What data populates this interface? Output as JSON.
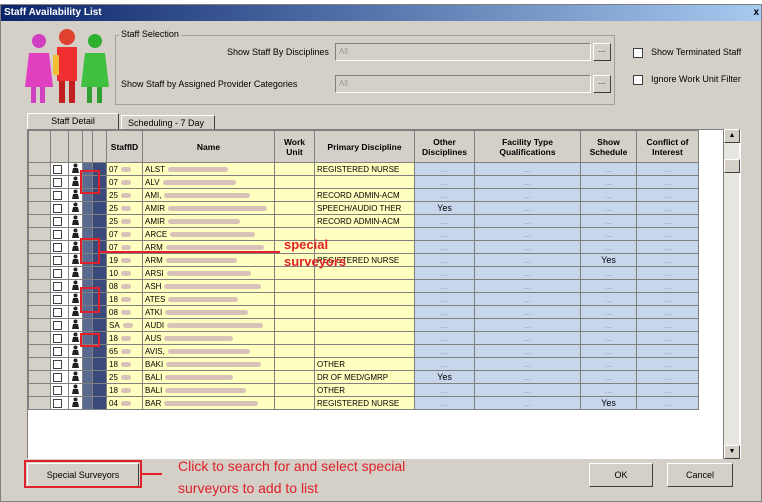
{
  "window": {
    "title": "Staff Availability List",
    "close": "x"
  },
  "selection": {
    "legend": "Staff Selection",
    "disciplines_label": "Show Staff By Disciplines",
    "disciplines_value": "All",
    "provider_label": "Show Staff by Assigned Provider Categories",
    "provider_value": "All",
    "show_terminated": "Show Terminated Staff",
    "ignore_work_unit": "Ignore Work Unit Filter"
  },
  "tabs": [
    "Staff Detail",
    "Scheduling - 7 Day"
  ],
  "grid": {
    "columns": [
      "StaffID",
      "Name",
      "Work Unit",
      "Primary Discipline",
      "Other Disciplines",
      "Facility Type Qualifications",
      "Show Schedule",
      "Conflict of Interest"
    ],
    "rows": [
      {
        "id": "07",
        "name": "ALST",
        "discipline": "REGISTERED NURSE",
        "other": "",
        "schedule": ""
      },
      {
        "id": "07",
        "name": "ALV",
        "discipline": "",
        "other": "",
        "schedule": ""
      },
      {
        "id": "25",
        "name": "AMI,",
        "discipline": "RECORD ADMIN-ACM",
        "other": "",
        "schedule": ""
      },
      {
        "id": "25",
        "name": "AMIR",
        "discipline": "SPEECH/AUDIO THER",
        "other": "Yes",
        "schedule": ""
      },
      {
        "id": "25",
        "name": "AMIR",
        "discipline": "RECORD ADMIN-ACM",
        "other": "",
        "schedule": ""
      },
      {
        "id": "07",
        "name": "ARCE",
        "discipline": "",
        "other": "",
        "schedule": ""
      },
      {
        "id": "07",
        "name": "ARM",
        "discipline": "",
        "other": "",
        "schedule": ""
      },
      {
        "id": "19",
        "name": "ARM",
        "discipline": "REGISTERED NURSE",
        "other": "",
        "schedule": "Yes"
      },
      {
        "id": "10",
        "name": "ARSI",
        "discipline": "",
        "other": "",
        "schedule": ""
      },
      {
        "id": "08",
        "name": "ASH",
        "discipline": "",
        "other": "",
        "schedule": ""
      },
      {
        "id": "18",
        "name": "ATES",
        "discipline": "",
        "other": "",
        "schedule": ""
      },
      {
        "id": "08",
        "name": "ATKI",
        "discipline": "",
        "other": "",
        "schedule": ""
      },
      {
        "id": "SA",
        "name": "AUDI",
        "discipline": "",
        "other": "",
        "schedule": ""
      },
      {
        "id": "18",
        "name": "AUS",
        "discipline": "",
        "other": "",
        "schedule": ""
      },
      {
        "id": "65",
        "name": "AVIS,",
        "discipline": "",
        "other": "",
        "schedule": ""
      },
      {
        "id": "18",
        "name": "BAKI",
        "discipline": "OTHER",
        "other": "",
        "schedule": ""
      },
      {
        "id": "25",
        "name": "BALI",
        "discipline": "DR OF MED/GMRP",
        "other": "Yes",
        "schedule": ""
      },
      {
        "id": "18",
        "name": "BALI",
        "discipline": "OTHER",
        "other": "",
        "schedule": ""
      },
      {
        "id": "04",
        "name": "BAR",
        "discipline": "REGISTERED NURSE",
        "other": "",
        "schedule": "Yes"
      }
    ],
    "blue_placeholder": "..."
  },
  "buttons": {
    "special": "Special Surveyors",
    "ok": "OK",
    "cancel": "Cancel"
  },
  "annotations": {
    "special_line1": "special",
    "special_line2": "surveyors",
    "click1": "Click to search for and select special",
    "click2": "surveyors to add to list"
  },
  "colors": {
    "accent_red": "#e0202a",
    "row_yellow": "#ffffc0",
    "cell_blue": "#c8d6ec"
  },
  "icons": [
    "people-logo-icon",
    "staff-person-icon",
    "staff-card-icon",
    "scroll-up-icon",
    "scroll-down-icon"
  ]
}
